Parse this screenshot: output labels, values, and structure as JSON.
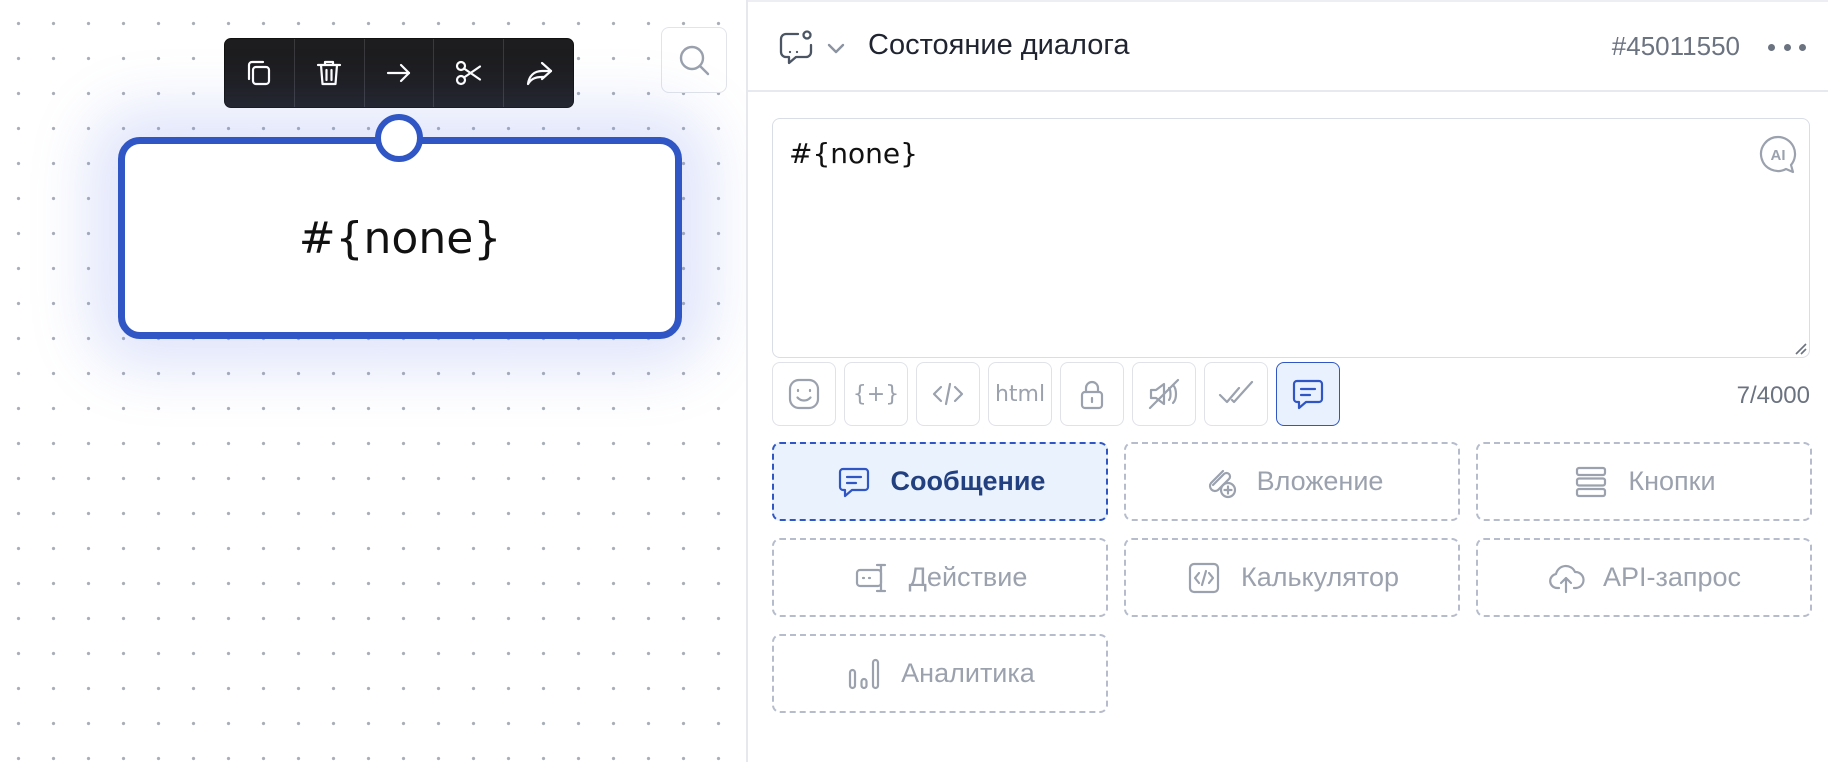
{
  "canvas": {
    "node": {
      "text": "#{none}"
    },
    "toolbar": {
      "buttons": [
        {
          "icon": "copy-icon"
        },
        {
          "icon": "trash-icon"
        },
        {
          "icon": "arrow-right-icon"
        },
        {
          "icon": "scissors-icon"
        },
        {
          "icon": "share-forward-icon"
        }
      ]
    },
    "search": {
      "icon": "search-icon"
    }
  },
  "panel": {
    "header": {
      "icon": "chat-bubble-icon",
      "title": "Состояние диалога",
      "id": "#45011550"
    },
    "editor": {
      "value": "#{none}",
      "ai_label": "AI",
      "counter": "7/4000"
    },
    "tools": [
      {
        "icon": "emoji-icon"
      },
      {
        "label": "{+}"
      },
      {
        "icon": "code-icon"
      },
      {
        "label": "html"
      },
      {
        "icon": "lock-icon"
      },
      {
        "icon": "voice-off-icon"
      },
      {
        "icon": "double-check-icon"
      },
      {
        "icon": "message-icon",
        "active": true
      }
    ],
    "blocks": [
      {
        "label": "Сообщение",
        "icon": "message-icon",
        "active": true
      },
      {
        "label": "Вложение",
        "icon": "attachment-icon"
      },
      {
        "label": "Кнопки",
        "icon": "buttons-icon"
      },
      {
        "label": "Действие",
        "icon": "action-icon"
      },
      {
        "label": "Калькулятор",
        "icon": "calculator-icon"
      },
      {
        "label": "API-запрос",
        "icon": "cloud-upload-icon"
      },
      {
        "label": "Аналитика",
        "icon": "analytics-icon"
      }
    ]
  },
  "colors": {
    "accent": "#2f56c4",
    "accent_bg": "#eaf2fe",
    "muted": "#9ba2ae",
    "toolbar_bg": "#1d1d1f"
  }
}
